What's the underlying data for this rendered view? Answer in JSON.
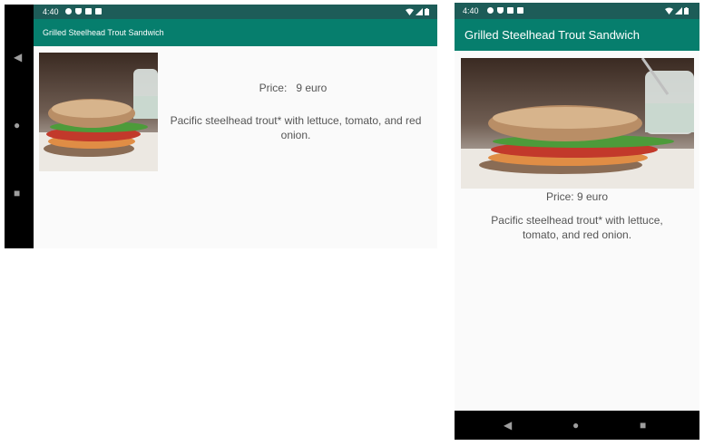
{
  "landscape": {
    "status_time": "4:40",
    "title": "Grilled Steelhead Trout Sandwich",
    "price_label": "Price:   9 euro",
    "description": "Pacific steelhead trout* with lettuce, tomato, and red onion."
  },
  "portrait": {
    "status_time": "4:40",
    "title": "Grilled Steelhead Trout Sandwich",
    "price_label": "Price: 9 euro",
    "description": "Pacific steelhead trout* with lettuce, tomato, and red onion."
  },
  "colors": {
    "status_bar": "#1d5c58",
    "app_bar": "#067e6d",
    "nav_bar": "#000000",
    "background": "#fafafa",
    "text": "#555555"
  },
  "icons": {
    "status_left": [
      "gear-icon",
      "shield-icon",
      "accessibility-icon",
      "sd-card-icon"
    ],
    "status_right": [
      "wifi-icon",
      "signal-icon",
      "battery-icon"
    ],
    "nav": [
      "back-icon",
      "home-icon",
      "recents-icon"
    ]
  }
}
